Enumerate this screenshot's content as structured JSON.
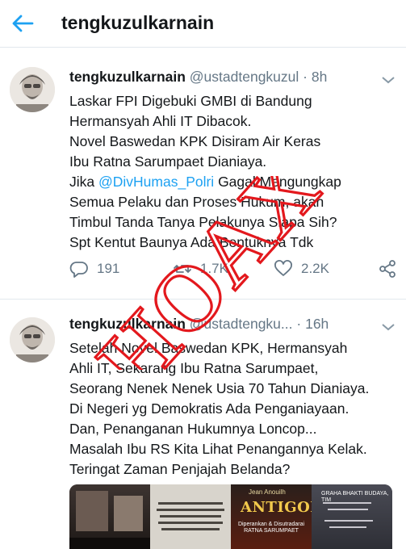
{
  "header": {
    "title": "tengkuzulkarnain"
  },
  "tweets": [
    {
      "name": "tengkuzulkarnain",
      "handle": "@ustadtengkuzul",
      "time": "· 8h",
      "lines": [
        "Laskar FPI Digebuki GMBI di Bandung",
        "Hermansyah Ahli IT Dibacok.",
        "Novel Baswedan KPK Disiram Air Keras",
        "Ibu Ratna Sarumpaet Dianiaya.",
        "Jika ",
        "Semua Pelaku dan Proses Hukum, akan",
        "Timbul Tanda Tanya Pelakunya Siapa Sih?",
        "Spt Kentut Baunya Ada Bentuknya Tdk"
      ],
      "mention": "@DivHumas_Polri",
      "after_mention": " Gagal Mengungkap",
      "replies": "191",
      "retweets": "1.7K",
      "likes": "2.2K"
    },
    {
      "name": "tengkuzulkarnain",
      "handle": "@ustadtengku...",
      "time": "· 16h",
      "lines": [
        "Setelah Novel Baswedan KPK, Hermansyah",
        "Ahli IT, Sekarang Ibu Ratna Sarumpaet,",
        "Seorang Nenek Nenek Usia 70 Tahun Dianiaya.",
        "Di Negeri yg Demokratis Ada Penganiayaan.",
        "Dan, Penanganan Hukumnya Loncop...",
        "Masalah Ibu RS Kita Lihat Penangannya Kelak.",
        "Teringat Zaman Penjajah Belanda?"
      ]
    }
  ],
  "media": {
    "poster_title": "ANTIGONE",
    "poster_author": "Jean Anouilh",
    "poster_credit": "Diperankan & Disutradarai RATNA SARUMPAET",
    "venue": "GRAHA BHAKTI BUDAYA, TIM"
  },
  "stamp": {
    "text": "HOAX",
    "color": "#e3181d"
  },
  "colors": {
    "accent": "#1da1f2",
    "muted": "#657786"
  }
}
